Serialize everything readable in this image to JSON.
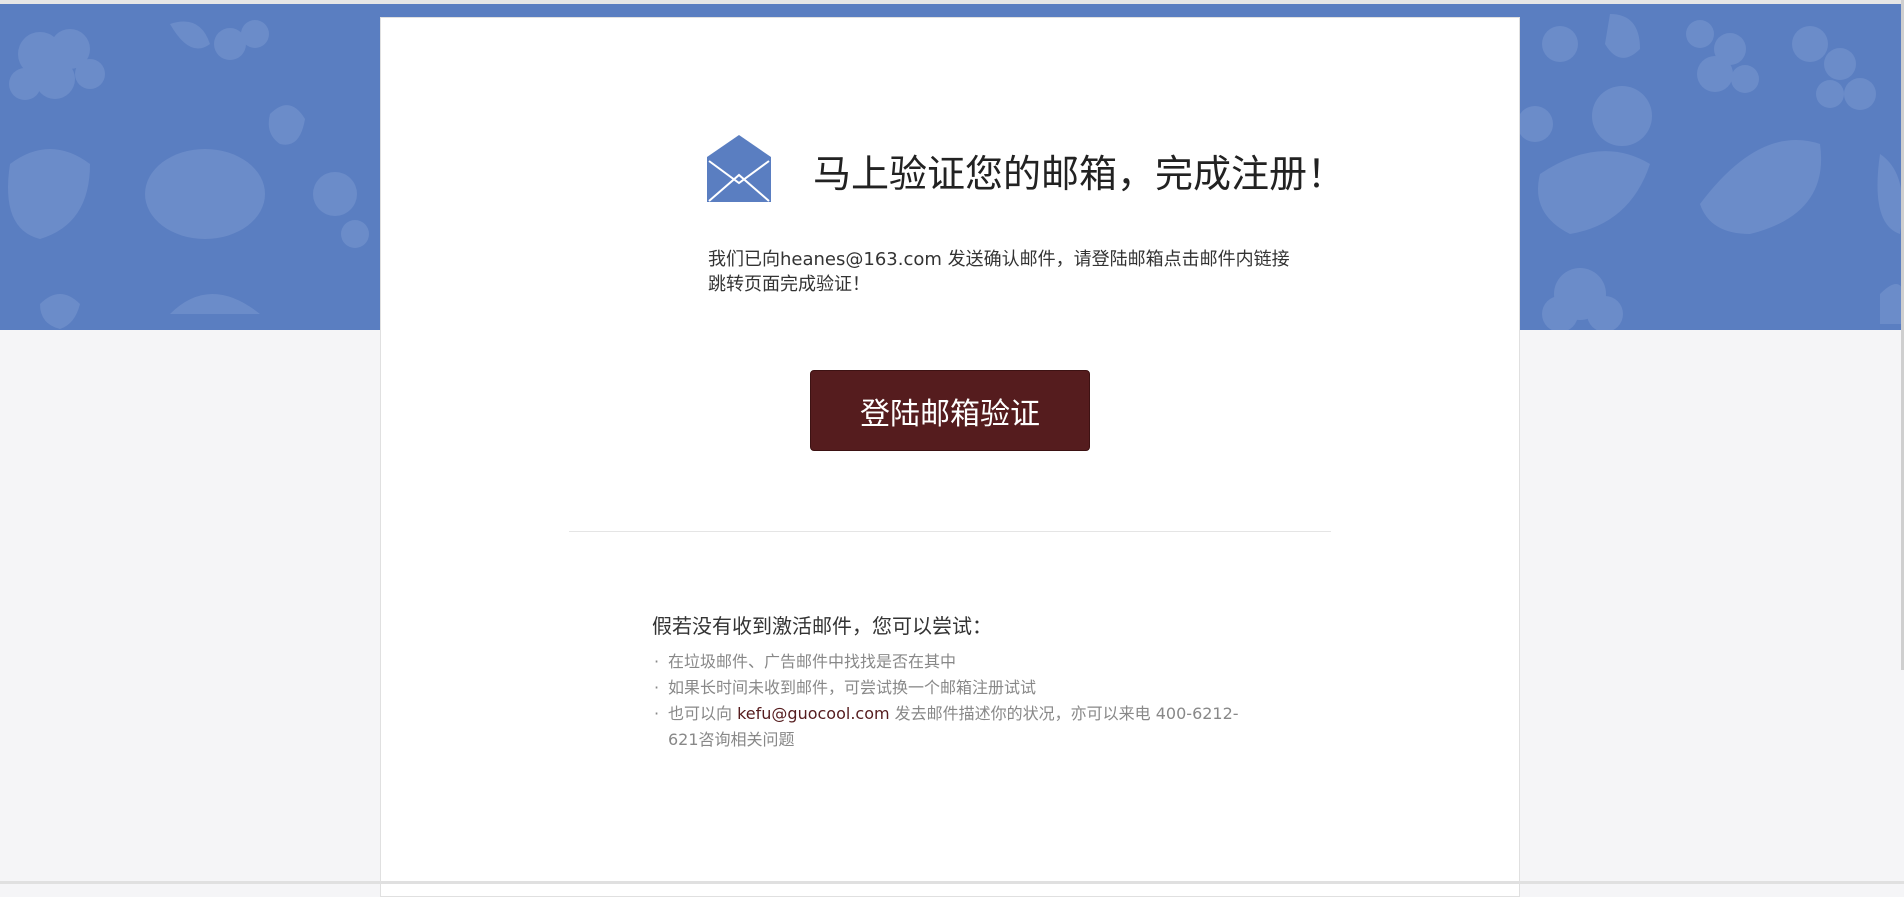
{
  "headline": "马上验证您的邮箱，完成注册！",
  "info": {
    "prefix": "我们已向",
    "email": "heanes@163.com",
    "suffix": " 发送确认邮件，请登陆邮箱点击邮件内链接跳转页面完成验证！"
  },
  "verify_button_label": "登陆邮箱验证",
  "tips": {
    "title": "假若没有收到激活邮件，您可以尝试：",
    "items": [
      "在垃圾邮件、广告邮件中找找是否在其中",
      "如果长时间未收到邮件，可尝试换一个邮箱注册试试"
    ],
    "third_prefix": "也可以向 ",
    "third_email": "kefu@guocool.com",
    "third_suffix": " 发去邮件描述你的状况，亦可以来电 400-6212-621咨询相关问题",
    "bullet": "·"
  },
  "colors": {
    "banner": "#5a7ec1",
    "button": "#551c1e",
    "icon": "#5a7ec1"
  },
  "icons": {
    "mail": "envelope-icon",
    "banner_pattern": "fruit-pattern"
  }
}
